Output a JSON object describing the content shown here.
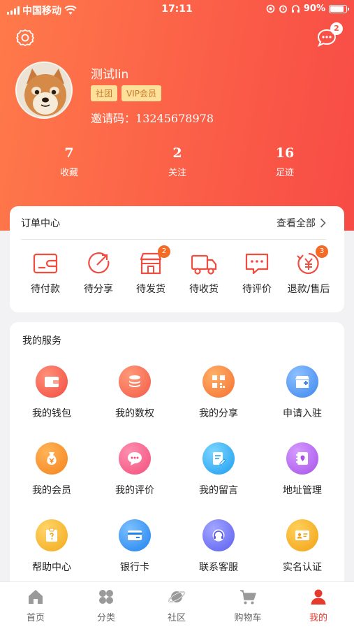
{
  "status_bar": {
    "carrier": "中国移动",
    "time": "17:11",
    "battery": "90%"
  },
  "header": {
    "message_count": "2"
  },
  "profile": {
    "username": "测试lin",
    "tags": [
      "社团",
      "VIP会员"
    ],
    "invite_label": "邀请码：",
    "invite_code": "13245678978"
  },
  "stats": [
    {
      "value": "7",
      "label": "收藏"
    },
    {
      "value": "2",
      "label": "关注"
    },
    {
      "value": "16",
      "label": "足迹"
    }
  ],
  "orders": {
    "title": "订单中心",
    "view_all": "查看全部",
    "items": [
      {
        "label": "待付款",
        "icon": "wallet-icon",
        "badge": null
      },
      {
        "label": "待分享",
        "icon": "share-icon",
        "badge": null
      },
      {
        "label": "待发货",
        "icon": "shop-icon",
        "badge": "2"
      },
      {
        "label": "待收货",
        "icon": "truck-icon",
        "badge": null
      },
      {
        "label": "待评价",
        "icon": "comment-icon",
        "badge": null
      },
      {
        "label": "退款/售后",
        "icon": "refund-icon",
        "badge": "3"
      }
    ]
  },
  "services": {
    "title": "我的服务",
    "items": [
      {
        "label": "我的钱包",
        "icon": "wallet-icon",
        "color": "#f6584a"
      },
      {
        "label": "我的数权",
        "icon": "coins-icon",
        "color": "#f5674a"
      },
      {
        "label": "我的分享",
        "icon": "qrcode-icon",
        "color": "#f7813f"
      },
      {
        "label": "申请入驻",
        "icon": "store-icon",
        "color": "#3f8ef0"
      },
      {
        "label": "我的会员",
        "icon": "money-bag-icon",
        "color": "#f78a2b"
      },
      {
        "label": "我的评价",
        "icon": "chat-icon",
        "color": "#f55784"
      },
      {
        "label": "我的留言",
        "icon": "note-icon",
        "color": "#2eaaf2"
      },
      {
        "label": "地址管理",
        "icon": "location-book-icon",
        "color": "#b264ea"
      },
      {
        "label": "帮助中心",
        "icon": "help-icon",
        "color": "#f5b92a"
      },
      {
        "label": "银行卡",
        "icon": "bank-card-icon",
        "color": "#2e8ef0"
      },
      {
        "label": "联系客服",
        "icon": "headset-icon",
        "color": "#6f6ef5"
      },
      {
        "label": "实名认证",
        "icon": "id-card-icon",
        "color": "#f5b12a"
      }
    ]
  },
  "tabbar": [
    {
      "label": "首页",
      "icon": "home-icon",
      "active": false
    },
    {
      "label": "分类",
      "icon": "category-icon",
      "active": false
    },
    {
      "label": "社区",
      "icon": "planet-icon",
      "active": false
    },
    {
      "label": "购物车",
      "icon": "cart-icon",
      "active": false
    },
    {
      "label": "我的",
      "icon": "user-icon",
      "active": true
    }
  ],
  "colors": {
    "header_gradient_start": "#ff7a4a",
    "header_gradient_end": "#f74b45",
    "accent": "#e53b2f",
    "tag_bg": "#fde09a",
    "tag_text": "#c9792a",
    "badge": "#f46a27"
  }
}
